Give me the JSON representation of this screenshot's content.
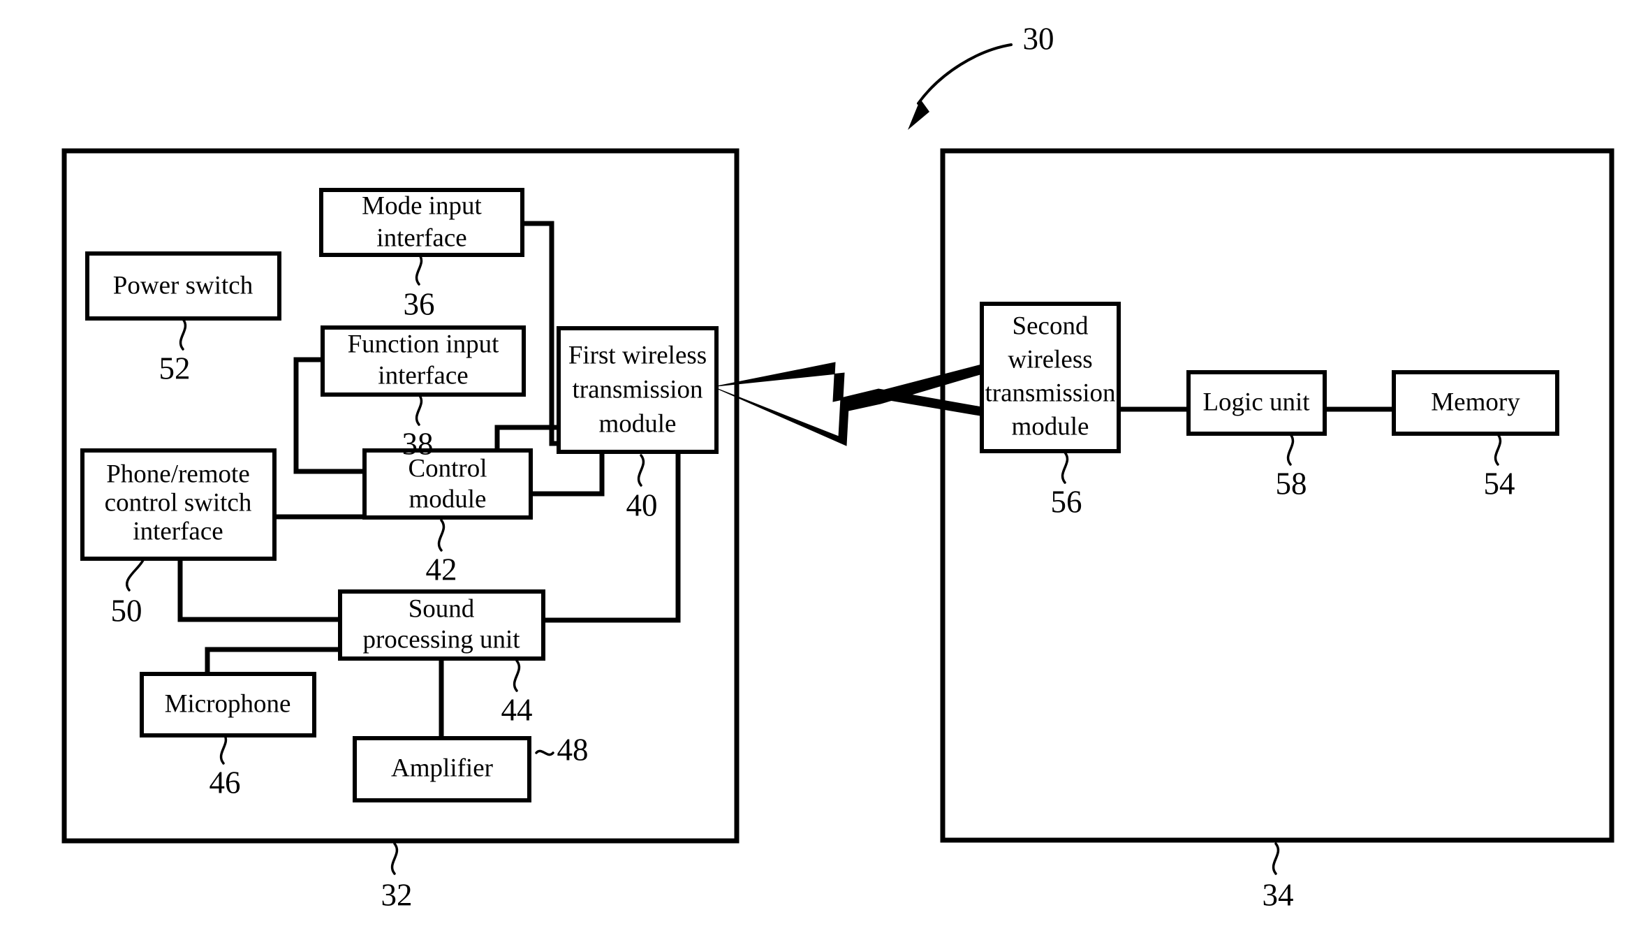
{
  "figure": {
    "figure_ref": "30",
    "left_panel": {
      "ref": "32",
      "blocks": {
        "power_switch": {
          "label": "Power switch",
          "ref": "52"
        },
        "mode_input_interface": {
          "label_line1": "Mode input",
          "label_line2": "interface",
          "ref": "36"
        },
        "function_input_interface": {
          "label_line1": "Function input",
          "label_line2": "interface",
          "ref": "38"
        },
        "first_wireless_transmission_module": {
          "label_line1": "First wireless",
          "label_line2": "transmission",
          "label_line3": "module",
          "ref": "40"
        },
        "phone_remote_control_switch_interface": {
          "label_line1": "Phone/remote",
          "label_line2": "control switch",
          "label_line3": "interface",
          "ref": "50"
        },
        "control_module": {
          "label_line1": "Control",
          "label_line2": "module",
          "ref": "42"
        },
        "sound_processing_unit": {
          "label_line1": "Sound",
          "label_line2": "processing unit",
          "ref": "44"
        },
        "microphone": {
          "label": "Microphone",
          "ref": "46"
        },
        "amplifier": {
          "label": "Amplifier",
          "ref": "48"
        }
      }
    },
    "right_panel": {
      "ref": "34",
      "blocks": {
        "second_wireless_transmission_module": {
          "label_line1": "Second",
          "label_line2": "wireless",
          "label_line3": "transmission",
          "label_line4": "module",
          "ref": "56"
        },
        "logic_unit": {
          "label": "Logic unit",
          "ref": "58"
        },
        "memory": {
          "label": "Memory",
          "ref": "54"
        }
      }
    },
    "colors": {
      "stroke": "#000000",
      "background": "#ffffff"
    }
  }
}
